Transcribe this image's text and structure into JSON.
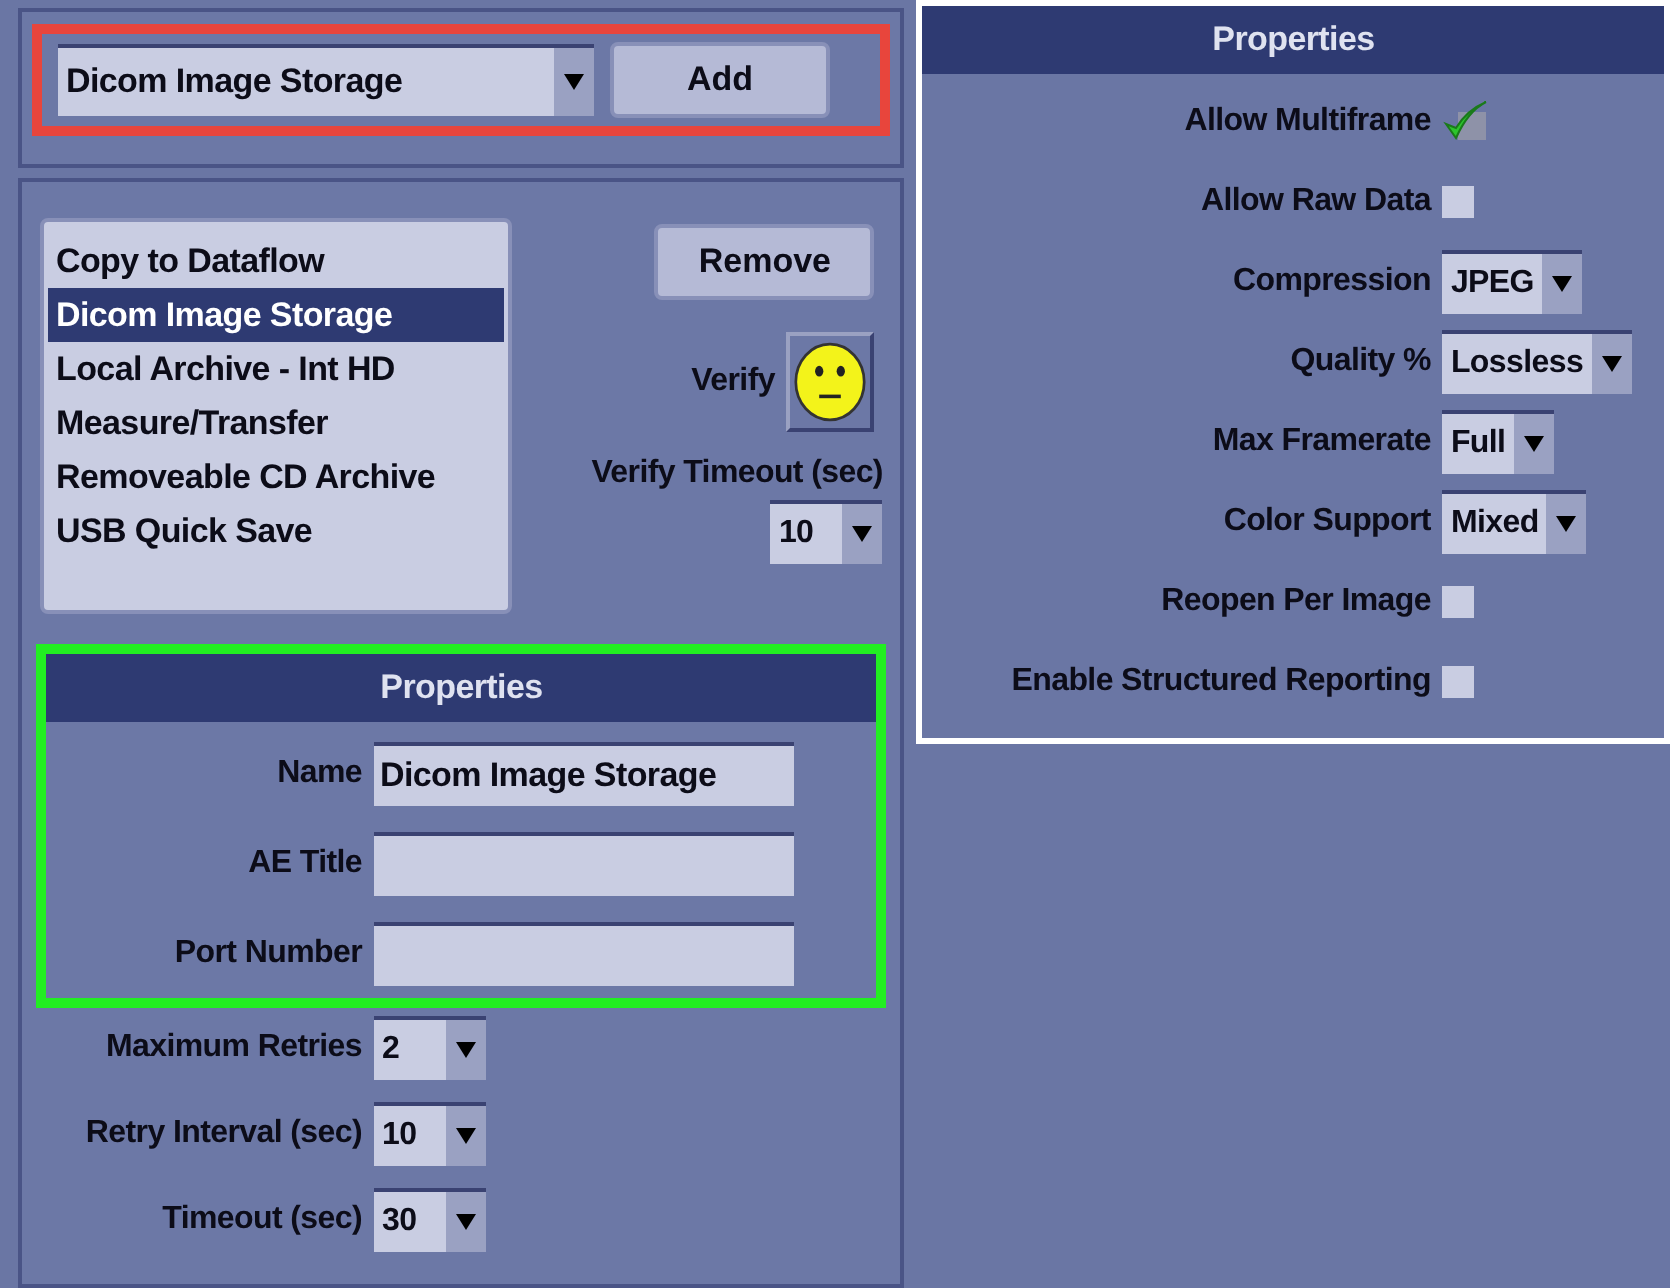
{
  "service_select": {
    "value": "Dicom Image Storage"
  },
  "add_button": "Add",
  "services": [
    {
      "label": "Copy to Dataflow",
      "selected": false
    },
    {
      "label": "Dicom Image Storage",
      "selected": true
    },
    {
      "label": "Local Archive - Int HD",
      "selected": false
    },
    {
      "label": "Measure/Transfer",
      "selected": false
    },
    {
      "label": "Removeable CD Archive",
      "selected": false
    },
    {
      "label": "USB Quick Save",
      "selected": false
    }
  ],
  "remove_button": "Remove",
  "verify": {
    "label": "Verify"
  },
  "verify_timeout": {
    "label": "Verify Timeout (sec)",
    "value": "10"
  },
  "properties_left": {
    "title": "Properties",
    "fields": [
      {
        "label": "Name",
        "value": "Dicom Image Storage"
      },
      {
        "label": "AE Title"
      },
      {
        "label": "Port Number"
      }
    ]
  },
  "retry_settings": [
    {
      "label": "Maximum Retries",
      "value": "2"
    },
    {
      "label": "Retry Interval (sec)",
      "value": "10"
    },
    {
      "label": "Timeout (sec)",
      "value": "30"
    }
  ],
  "properties_right": {
    "title": "Properties",
    "rows": [
      {
        "kind": "checkbox",
        "label": "Allow Multiframe",
        "checked": true
      },
      {
        "kind": "checkbox",
        "label": "Allow Raw Data",
        "checked": false
      },
      {
        "kind": "select",
        "label": "Compression",
        "value": "JPEG"
      },
      {
        "kind": "select",
        "label": "Quality %",
        "value": "Lossless"
      },
      {
        "kind": "select",
        "label": "Max Framerate",
        "value": "Full"
      },
      {
        "kind": "select",
        "label": "Color Support",
        "value": "Mixed"
      },
      {
        "kind": "checkbox",
        "label": "Reopen Per Image",
        "checked": false
      },
      {
        "kind": "checkbox",
        "label": "Enable Structured Reporting",
        "checked": false
      }
    ]
  }
}
